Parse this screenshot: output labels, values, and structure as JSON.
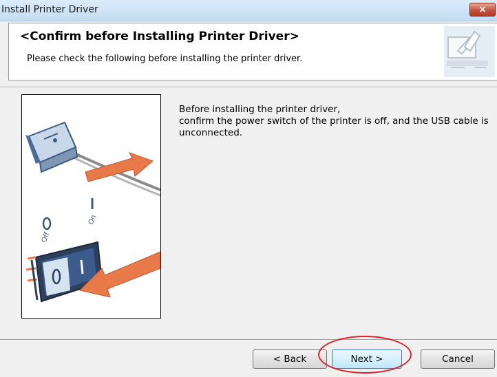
{
  "window": {
    "title": "Install Printer Driver",
    "close_symbol": "×"
  },
  "header": {
    "title": "<Confirm before Installing Printer Driver>",
    "subtitle": "Please check the following before installing the printer driver.",
    "graphic_icon": "install-wizard-icon"
  },
  "illustration": {
    "icon": "usb-cable-and-power-switch-illustration",
    "off_label": "Off",
    "on_label": "On"
  },
  "message": {
    "line1": "Before installing the printer driver,",
    "line2": "confirm the power switch of the printer is off, and the USB cable is",
    "line3": "unconnected."
  },
  "buttons": {
    "back": "< Back",
    "next": "Next >",
    "cancel": "Cancel"
  },
  "annotation": {
    "highlight_color": "#d9252a"
  }
}
